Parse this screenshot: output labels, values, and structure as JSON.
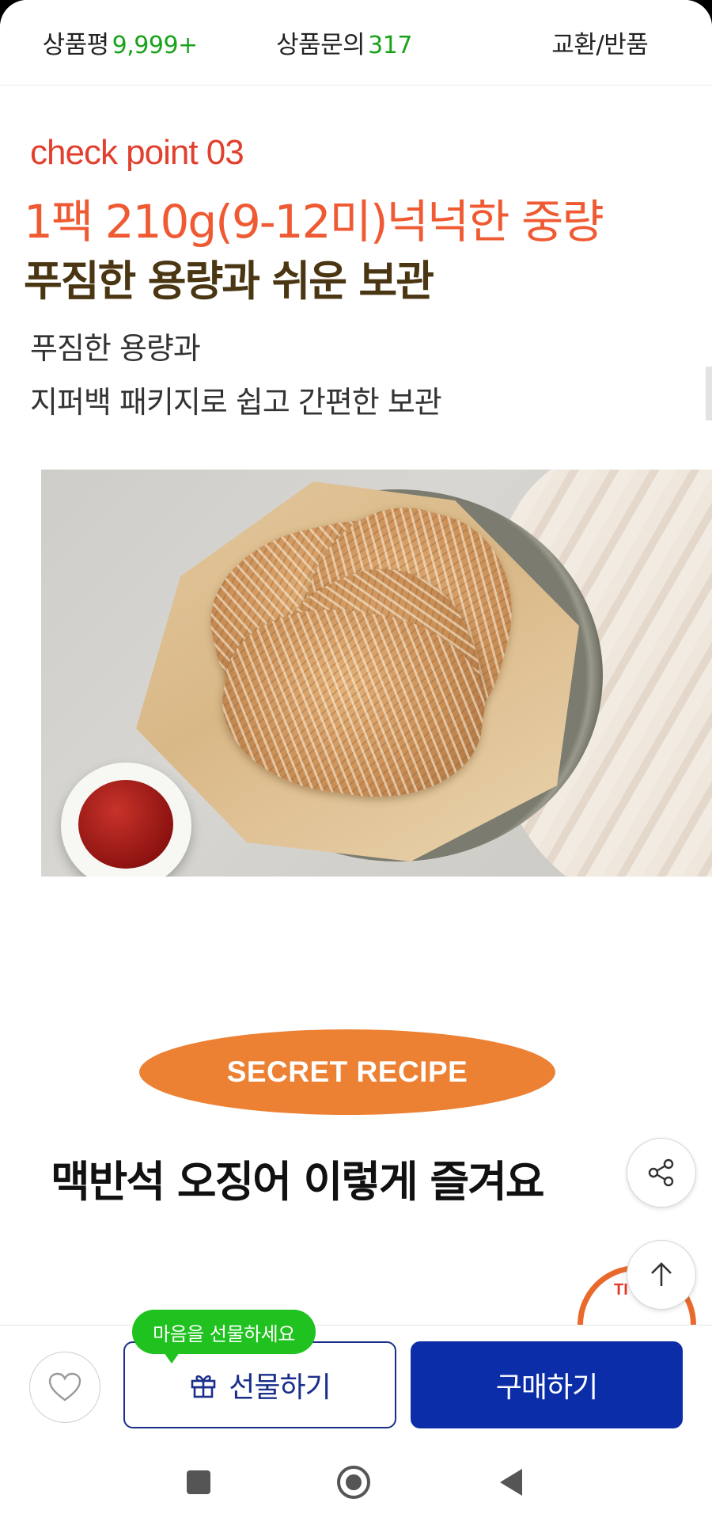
{
  "tabs": [
    {
      "label": "상품평",
      "count": "9,999+"
    },
    {
      "label": "상품문의",
      "count": "317"
    },
    {
      "label": "교환/반품",
      "count": ""
    }
  ],
  "checkpoint": {
    "kicker": "check point 03",
    "headline": "1팩 210g(9-12미)넉넉한 중량",
    "subheadline": "푸짐한 용량과 쉬운 보관",
    "desc_line1": "푸짐한 용량과",
    "desc_line2": "지퍼백 패키지로 쉽고 간편한 보관"
  },
  "recipe": {
    "pill": "SECRET RECIPE",
    "title": "맥반석 오징어 이렇게 즐겨요",
    "badge_peek": "TI"
  },
  "bottom": {
    "gift_tooltip": "마음을 선물하세요",
    "gift_label": "선물하기",
    "buy_label": "구매하기"
  },
  "colors": {
    "accent_red": "#e2402f",
    "accent_orange": "#ef5a33",
    "count_green": "#1aa31a",
    "buy_blue": "#0b2ea8",
    "tooltip_green": "#1fc21f"
  },
  "icons": [
    "share-icon",
    "arrow-up-icon",
    "heart-icon",
    "gift-icon",
    "square-icon",
    "circle-icon",
    "triangle-back-icon"
  ]
}
